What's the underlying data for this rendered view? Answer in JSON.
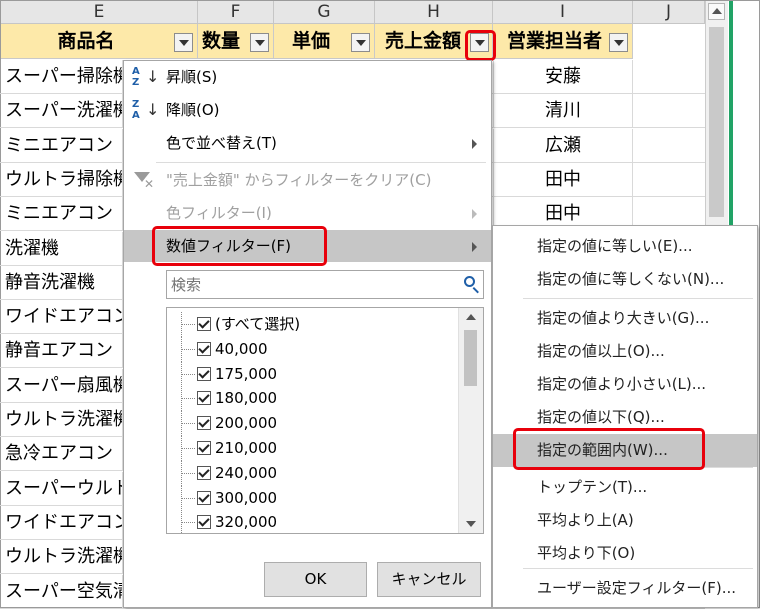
{
  "columns": {
    "E": "E",
    "F": "F",
    "G": "G",
    "H": "H",
    "I": "I",
    "J": "J"
  },
  "headers": {
    "product": "商品名",
    "qty": "数量",
    "price": "単価",
    "sales": "売上金額",
    "rep": "営業担当者"
  },
  "rows": [
    {
      "product": "スーパー掃除機",
      "rep": "安藤"
    },
    {
      "product": "スーパー洗濯機",
      "rep": "清川"
    },
    {
      "product": "ミニエアコン",
      "rep": "広瀬"
    },
    {
      "product": "ウルトラ掃除機",
      "rep": "田中"
    },
    {
      "product": "ミニエアコン",
      "rep": "田中"
    },
    {
      "product": "洗濯機",
      "rep": ""
    },
    {
      "product": "静音洗濯機",
      "rep": ""
    },
    {
      "product": "ワイドエアコン",
      "rep": ""
    },
    {
      "product": "静音エアコン",
      "rep": ""
    },
    {
      "product": "スーパー扇風機",
      "rep": ""
    },
    {
      "product": "ウルトラ洗濯機",
      "rep": ""
    },
    {
      "product": "急冷エアコン",
      "rep": ""
    },
    {
      "product": "スーパーウルトラ",
      "rep": ""
    },
    {
      "product": "ワイドエアコン",
      "rep": ""
    },
    {
      "product": "ウルトラ洗濯機",
      "rep": ""
    },
    {
      "product": "スーパー空気清浄機",
      "rep": ""
    }
  ],
  "menu": {
    "sort_asc": "昇順(S)",
    "sort_desc": "降順(O)",
    "sort_color": "色で並べ替え(T)",
    "clear_filter": "\"売上金額\" からフィルターをクリア(C)",
    "color_filter": "色フィルター(I)",
    "number_filter": "数値フィルター(F)",
    "search_placeholder": "検索",
    "ok": "OK",
    "cancel": "キャンセル"
  },
  "sort_icon": {
    "asc_top": "A",
    "asc_bottom": "Z",
    "desc_top": "Z",
    "desc_bottom": "A",
    "arrow": "↓"
  },
  "values": [
    "(すべて選択)",
    "40,000",
    "175,000",
    "180,000",
    "200,000",
    "210,000",
    "240,000",
    "300,000",
    "320,000"
  ],
  "submenu": [
    "指定の値に等しい(E)...",
    "指定の値に等しくない(N)...",
    "指定の値より大きい(G)...",
    "指定の値以上(O)...",
    "指定の値より小さい(L)...",
    "指定の値以下(Q)...",
    "指定の範囲内(W)...",
    "トップテン(T)...",
    "平均より上(A)",
    "平均より下(O)",
    "ユーザー設定フィルター(F)..."
  ],
  "colors": {
    "highlight": "#e8000b",
    "header_fill": "#fde9a9",
    "menu_highlight": "#c6c6c6",
    "excel_green": "#21a366"
  }
}
